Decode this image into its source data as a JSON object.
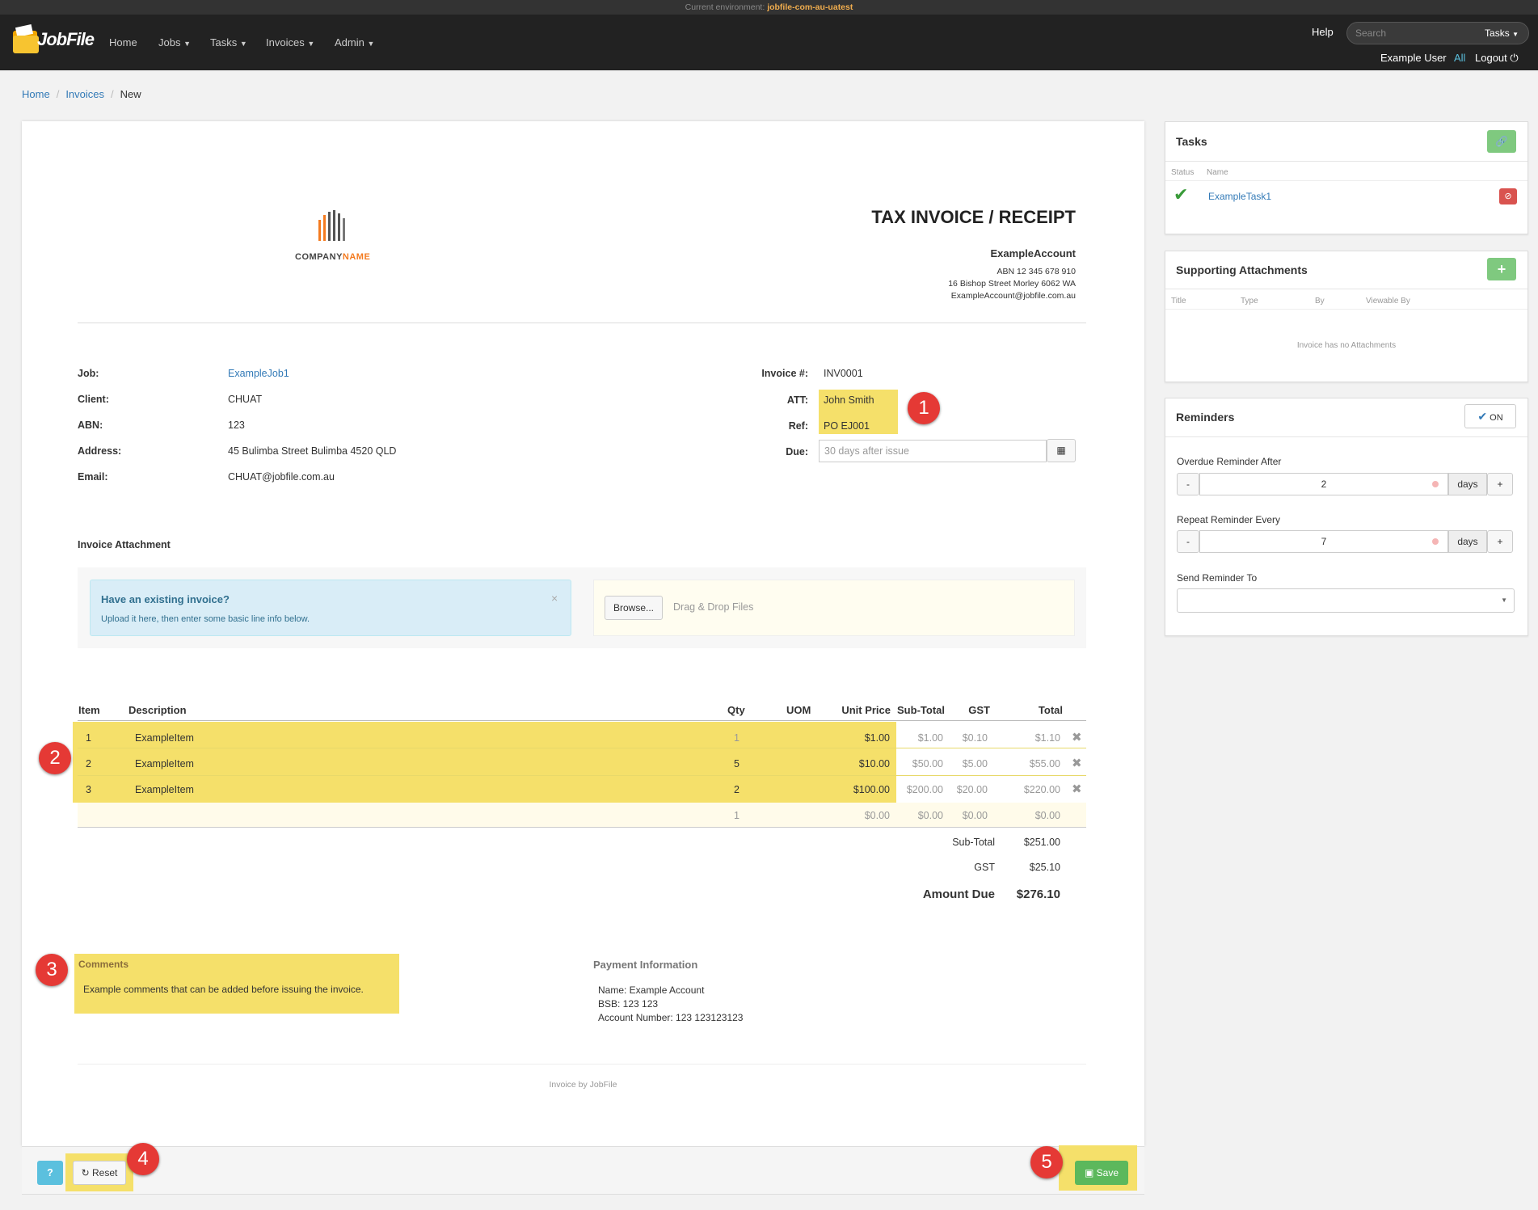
{
  "env": {
    "label": "Current environment:",
    "name": "jobfile-com-au-uatest"
  },
  "nav": {
    "brand": "JobFile",
    "home": "Home",
    "jobs": "Jobs",
    "tasks": "Tasks",
    "invoices": "Invoices",
    "admin": "Admin",
    "help": "Help",
    "search_placeholder": "Search",
    "search_scope": "Tasks",
    "user": "Example User",
    "all": "All",
    "logout": "Logout"
  },
  "breadcrumb": [
    "Home",
    "Invoices",
    "New"
  ],
  "company": {
    "logo_text": "COMPANY",
    "logo_text2": "NAME"
  },
  "invoice": {
    "heading": "TAX INVOICE / RECEIPT",
    "account": "ExampleAccount",
    "abn": "ABN 12 345 678 910",
    "address": "16 Bishop Street Morley 6062 WA",
    "email": "ExampleAccount@jobfile.com.au"
  },
  "details": {
    "job_label": "Job:",
    "job": "ExampleJob1",
    "client_label": "Client:",
    "client": "CHUAT",
    "abn_label": "ABN:",
    "abn": "123",
    "address_label": "Address:",
    "address": "45 Bulimba Street Bulimba 4520 QLD",
    "email_label": "Email:",
    "email": "CHUAT@jobfile.com.au",
    "invno_label": "Invoice #:",
    "invno": "INV0001",
    "att_label": "ATT:",
    "att": "John Smith",
    "ref_label": "Ref:",
    "ref": "PO EJ001",
    "due_label": "Due:",
    "due_placeholder": "30 days after issue"
  },
  "attachment": {
    "title": "Invoice Attachment",
    "alert_title": "Have an existing invoice?",
    "alert_text": "Upload it here, then enter some basic line info below.",
    "browse": "Browse...",
    "drop": "Drag & Drop Files"
  },
  "table": {
    "headers": [
      "Item",
      "Description",
      "Qty",
      "UOM",
      "Unit Price",
      "Sub-Total",
      "GST",
      "Total"
    ],
    "rows": [
      {
        "item": "1",
        "desc": "ExampleItem",
        "qty": "1",
        "uom": "",
        "price": "$1.00",
        "sub": "$1.00",
        "gst": "$0.10",
        "total": "$1.10"
      },
      {
        "item": "2",
        "desc": "ExampleItem",
        "qty": "5",
        "uom": "",
        "price": "$10.00",
        "sub": "$50.00",
        "gst": "$5.00",
        "total": "$55.00"
      },
      {
        "item": "3",
        "desc": "ExampleItem",
        "qty": "2",
        "uom": "",
        "price": "$100.00",
        "sub": "$200.00",
        "gst": "$20.00",
        "total": "$220.00"
      },
      {
        "item": "",
        "desc": "",
        "qty": "1",
        "uom": "",
        "price": "$0.00",
        "sub": "$0.00",
        "gst": "$0.00",
        "total": "$0.00"
      }
    ]
  },
  "totals": {
    "sub_label": "Sub-Total",
    "sub": "$251.00",
    "gst_label": "GST",
    "gst": "$25.10",
    "due_label": "Amount Due",
    "due": "$276.10"
  },
  "comments": {
    "title": "Comments",
    "text": "Example comments that can be added before issuing the invoice."
  },
  "payment": {
    "title": "Payment Information",
    "name": "Name: Example Account",
    "bsb": "BSB: 123 123",
    "account": "Account Number: 123 123123123"
  },
  "footer_note": "Invoice by JobFile",
  "actions": {
    "help": "?",
    "reset": "Reset",
    "save": "Save"
  },
  "badges": [
    "1",
    "2",
    "3",
    "4",
    "5"
  ],
  "tasks_panel": {
    "title": "Tasks",
    "col_status": "Status",
    "col_name": "Name",
    "task": "ExampleTask1"
  },
  "attach_panel": {
    "title": "Supporting Attachments",
    "cols": [
      "Title",
      "Type",
      "By",
      "Viewable By"
    ],
    "empty": "Invoice has no Attachments"
  },
  "reminders": {
    "title": "Reminders",
    "toggle": "ON",
    "overdue_label": "Overdue Reminder After",
    "overdue_value": "2",
    "repeat_label": "Repeat Reminder Every",
    "repeat_value": "7",
    "unit": "days",
    "minus": "-",
    "plus": "+",
    "send_label": "Send Reminder To"
  },
  "colors": {
    "highlight": "#f5e06a",
    "link": "#337ab7",
    "save": "#5cb85c",
    "badge": "#e53935"
  }
}
